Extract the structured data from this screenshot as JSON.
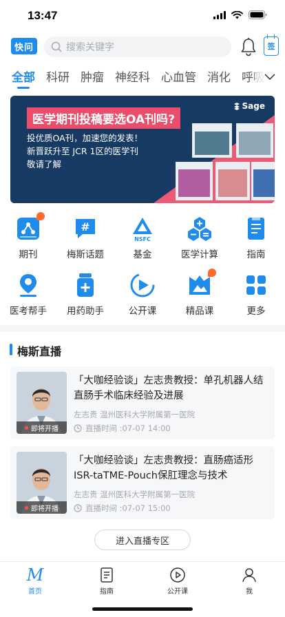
{
  "status_bar": {
    "time": "13:47"
  },
  "header": {
    "logo_text": "快问",
    "search_placeholder": "搜索关键字",
    "sign_text": "签"
  },
  "tabs": [
    {
      "label": "全部",
      "active": true
    },
    {
      "label": "科研"
    },
    {
      "label": "肿瘤"
    },
    {
      "label": "神经科"
    },
    {
      "label": "心血管"
    },
    {
      "label": "消化"
    },
    {
      "label": "呼吸"
    }
  ],
  "banner": {
    "title": "医学期刊投稿要选OA刊吗?",
    "line1": "投优质OA刊，加速您的发表！",
    "line2": "新晋跃升至 JCR 1区的医学刊",
    "line3": "敬请了解",
    "brand": "Sage"
  },
  "grid": [
    {
      "label": "期刊",
      "icon": "journal-icon"
    },
    {
      "label": "梅斯话题",
      "icon": "topic-icon"
    },
    {
      "label": "基金",
      "icon": "nsfc-icon"
    },
    {
      "label": "医学计算",
      "icon": "calculator-icon"
    },
    {
      "label": "指南",
      "icon": "guide-icon"
    },
    {
      "label": "医考帮手",
      "icon": "exam-icon"
    },
    {
      "label": "用药助手",
      "icon": "medicine-icon"
    },
    {
      "label": "公开课",
      "icon": "course-icon"
    },
    {
      "label": "精品课",
      "icon": "premium-course-icon"
    },
    {
      "label": "更多",
      "icon": "more-icon"
    }
  ],
  "live_section": {
    "title": "梅斯直播",
    "items": [
      {
        "title": "「大咖经验谈」左志贵教授：单孔机器人结直肠手术临床经验及进展",
        "speaker": "左志贵 温州医科大学附属第一医院",
        "time": "直播时间 :07-07 14:00",
        "tag": "即将开播"
      },
      {
        "title": "「大咖经验谈」左志贵教授：直肠癌适形ISR-taTME-Pouch保肛理念与技术",
        "speaker": "左志贵 温州医科大学附属第一医院",
        "time": "直播时间 :07-07 15:00",
        "tag": "即将开播"
      }
    ],
    "enter_button": "进入直播专区"
  },
  "bottom_nav": [
    {
      "label": "首页",
      "active": true
    },
    {
      "label": "指南"
    },
    {
      "label": "公开课"
    },
    {
      "label": "我"
    }
  ],
  "colors": {
    "accent": "#1f8ceb",
    "banner_bg": "#173a63",
    "banner_pink": "#ec4d6b"
  }
}
